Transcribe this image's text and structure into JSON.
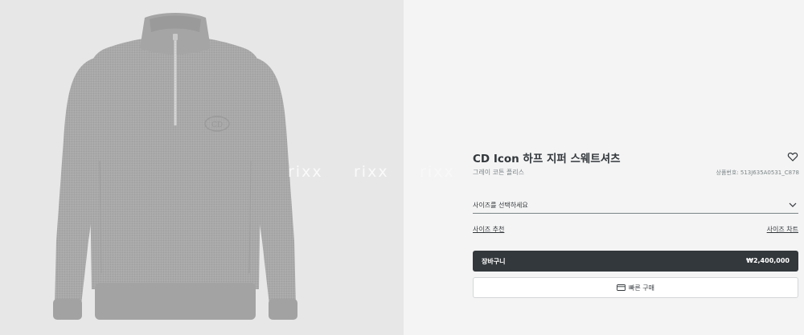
{
  "product": {
    "title": "CD Icon 하프 지퍼 스웨트셔츠",
    "subtitle": "그레이 코튼 플리스",
    "reference": "상품번호: 513J635A0531_C878",
    "image_alt": "그레이 하프 지퍼 스웨트셔츠"
  },
  "size": {
    "placeholder": "사이즈를 선택하세요"
  },
  "links": {
    "recommend": "사이즈 추천",
    "chart": "사이즈 차트"
  },
  "cart": {
    "label": "장바구니",
    "price": "₩2,400,000"
  },
  "quick_buy": {
    "label": "빠른 구매"
  },
  "watermarks": [
    "rixx",
    "rixx",
    "rixx"
  ],
  "icons": {
    "wishlist": "heart-icon",
    "size_toggle": "chevron-down-icon",
    "quick_buy": "credit-card-icon"
  },
  "colors": {
    "primary": "#33383c",
    "muted": "#7b8487",
    "background": "#f4f4f4",
    "image_background": "#e7e7e7",
    "garment": "#a9a9a9"
  }
}
